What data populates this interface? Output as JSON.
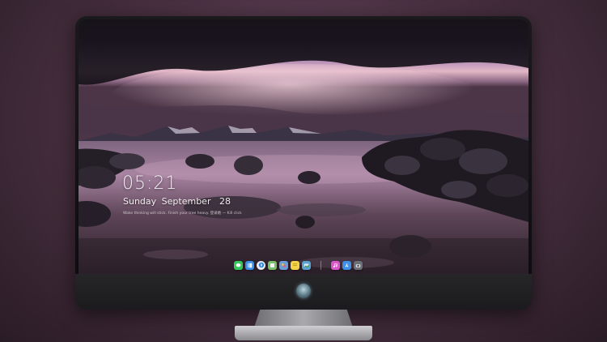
{
  "lock_screen": {
    "time": "05:21",
    "weekday": "Sunday",
    "month": "September",
    "day": "28",
    "note": "Wake thinking will stick. Finish your tree heavy. 登录她 — Kill click"
  },
  "dock": {
    "apps": [
      {
        "name": "messages-icon",
        "color": "#34c759"
      },
      {
        "name": "finder-icon",
        "color": "#3a8ee6"
      },
      {
        "name": "safari-icon",
        "color": "#e9e9ee"
      },
      {
        "name": "notes-icon",
        "color": "#7bbf6a"
      },
      {
        "name": "photos-icon",
        "color": "#6a9ed8"
      },
      {
        "name": "stickies-icon",
        "color": "#f3d34a"
      },
      {
        "name": "preview-icon",
        "color": "#5aa3d0"
      },
      {
        "name": "music-icon",
        "color": "#d957c9"
      },
      {
        "name": "appstore-icon",
        "color": "#3e8fe6"
      },
      {
        "name": "camera-icon",
        "color": "#6b7076"
      }
    ]
  }
}
